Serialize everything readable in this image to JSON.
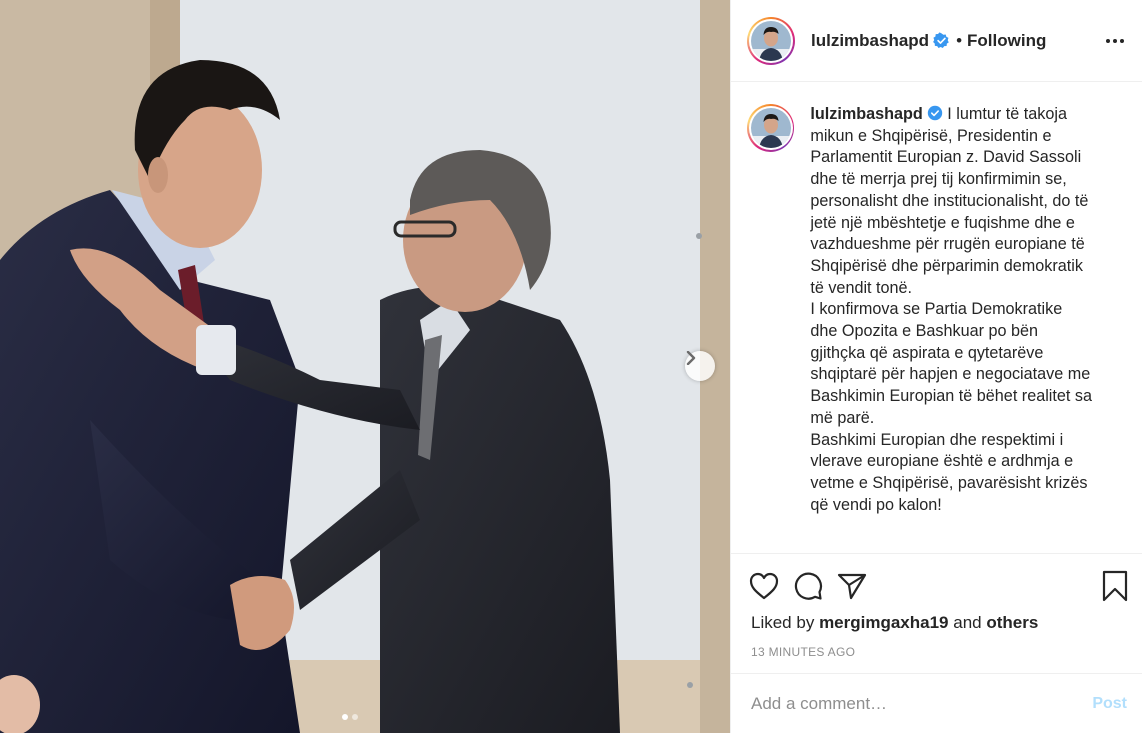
{
  "post": {
    "username": "lulzimbashapd",
    "follow_status": "Following",
    "bullet": "•",
    "caption_lines": [
      "I lumtur të takoja",
      "mikun e Shqipërisë, Presidentin e",
      "Parlamentit Europian z. David Sassoli",
      "dhe të merrja prej tij konfirmimin se,",
      "personalisht dhe institucionalisht, do të",
      "jetë një mbështetje e fuqishme dhe e",
      "vazhdueshme për rrugën europiane të",
      "Shqipërisë dhe përparimin demokratik",
      "të vendit tonë.",
      "I konfirmova se Partia Demokratike",
      "dhe Opozita e Bashkuar po bën",
      "gjithçka që aspirata e qytetarëve",
      "shqiptarë për hapjen e negociatave me",
      "Bashkimin Europian të bëhet realitet sa",
      "më parë.",
      "Bashkimi Europian dhe respektimi i",
      "vlerave europiane është e ardhmja e",
      "vetme e Shqipërisë, pavarësisht krizës",
      "që vendi po kalon!"
    ],
    "likes": {
      "prefix": "Liked by",
      "user": "mergimgaxha19",
      "joiner": "and",
      "others": "others"
    },
    "timestamp": "13 MINUTES AGO",
    "comment": {
      "placeholder": "Add a comment…",
      "post_label": "Post"
    },
    "carousel": {
      "total": 2,
      "current": 1
    }
  },
  "icons": {
    "verified": "verified-badge-icon",
    "more": "more-options-icon",
    "like": "heart-icon",
    "comment": "comment-icon",
    "share": "share-icon",
    "save": "bookmark-icon",
    "next": "chevron-right-icon"
  },
  "colors": {
    "verified_blue": "#3897f0",
    "post_button_disabled": "#b2dffc",
    "muted_text": "#8e8e8e",
    "text": "#262626"
  }
}
